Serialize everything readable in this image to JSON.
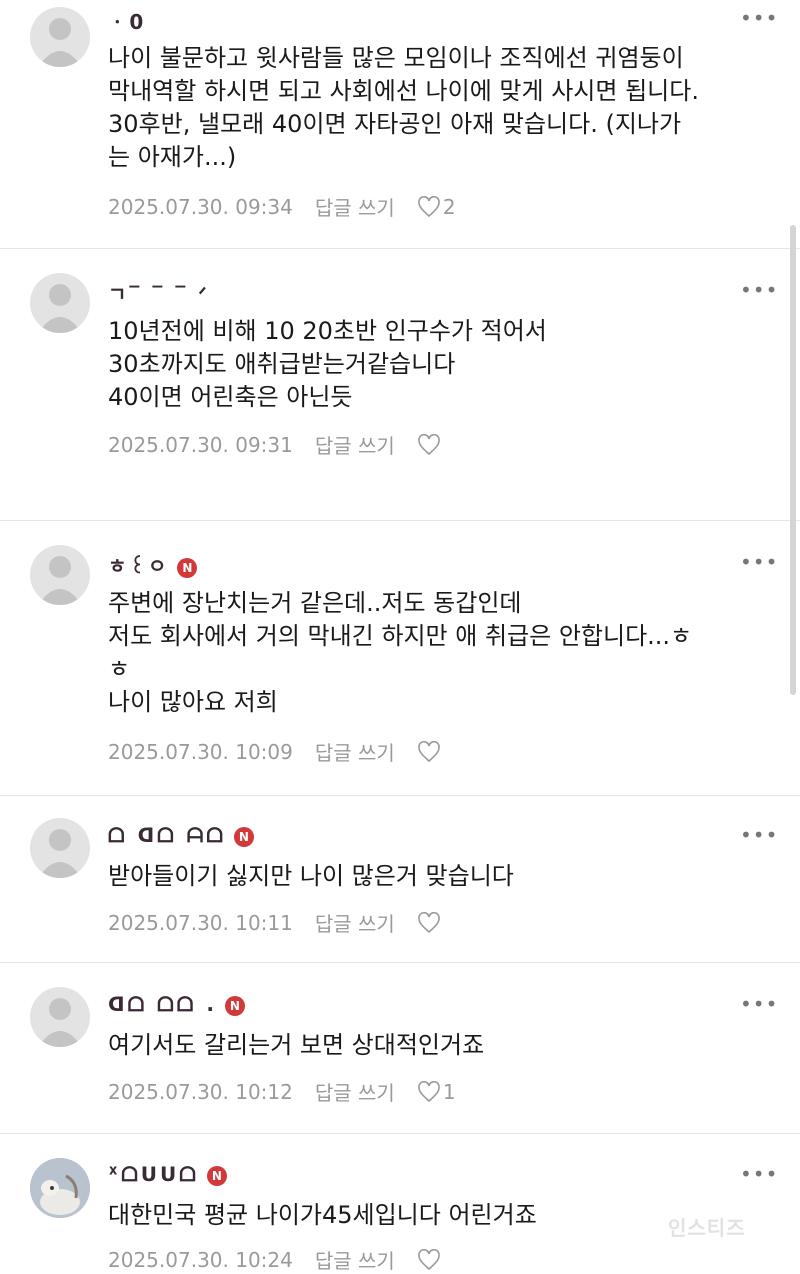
{
  "reply_label": "답글 쓰기",
  "comments": [
    {
      "nickname": "ㆍ0",
      "has_n_badge": false,
      "lines": [
        "나이 불문하고 윗사람들 많은 모임이나 조직에선 귀염둥이",
        "막내역할 하시면 되고 사회에선 나이에 맞게 사시면 됩니다.",
        "30후반, 낼모래 40이면 자타공인 아재 맞습니다. (지나가",
        "는 아재가...)"
      ],
      "date": "2025.07.30. 09:34",
      "likes": "2"
    },
    {
      "nickname": "ㄱ‾ ‾ ‾ ᐟ",
      "has_n_badge": false,
      "lines": [
        "10년전에 비해 10 20초반 인구수가 적어서",
        "30초까지도 애취급받는거같습니다",
        "40이면 어린축은 아닌듯"
      ],
      "date": "2025.07.30. 09:31",
      "likes": ""
    },
    {
      "nickname": "ㅎ꒰ㅇ",
      "has_n_badge": true,
      "lines": [
        "주변에 장난치는거 같은데..저도 동갑인데",
        "저도 회사에서 거의 막내긴 하지만 애 취급은 안합니다...ㅎ",
        "ㅎ",
        "나이 많아요 저희"
      ],
      "date": "2025.07.30. 10:09",
      "likes": ""
    },
    {
      "nickname": "ᗝ ᗡᗝ ᗩᗝ",
      "has_n_badge": true,
      "lines": [
        "받아들이기 싫지만 나이 많은거 맞습니다"
      ],
      "date": "2025.07.30. 10:11",
      "likes": ""
    },
    {
      "nickname": "ᗡᗝ  ᗝᗝ .",
      "has_n_badge": true,
      "lines": [
        "여기서도 갈리는거 보면 상대적인거죠"
      ],
      "date": "2025.07.30. 10:12",
      "likes": "1"
    },
    {
      "nickname": "ᕁᗝᑌᑌᗝ",
      "has_n_badge": true,
      "lines": [
        "대한민국 평균 나이가45세입니다 어린거죠"
      ],
      "date": "2025.07.30. 10:24",
      "likes": ""
    }
  ],
  "watermark": "인스티즈",
  "colors": {
    "badge": "#d23a3a",
    "meta": "#9a9a9a",
    "divider": "#e6e6e6"
  }
}
